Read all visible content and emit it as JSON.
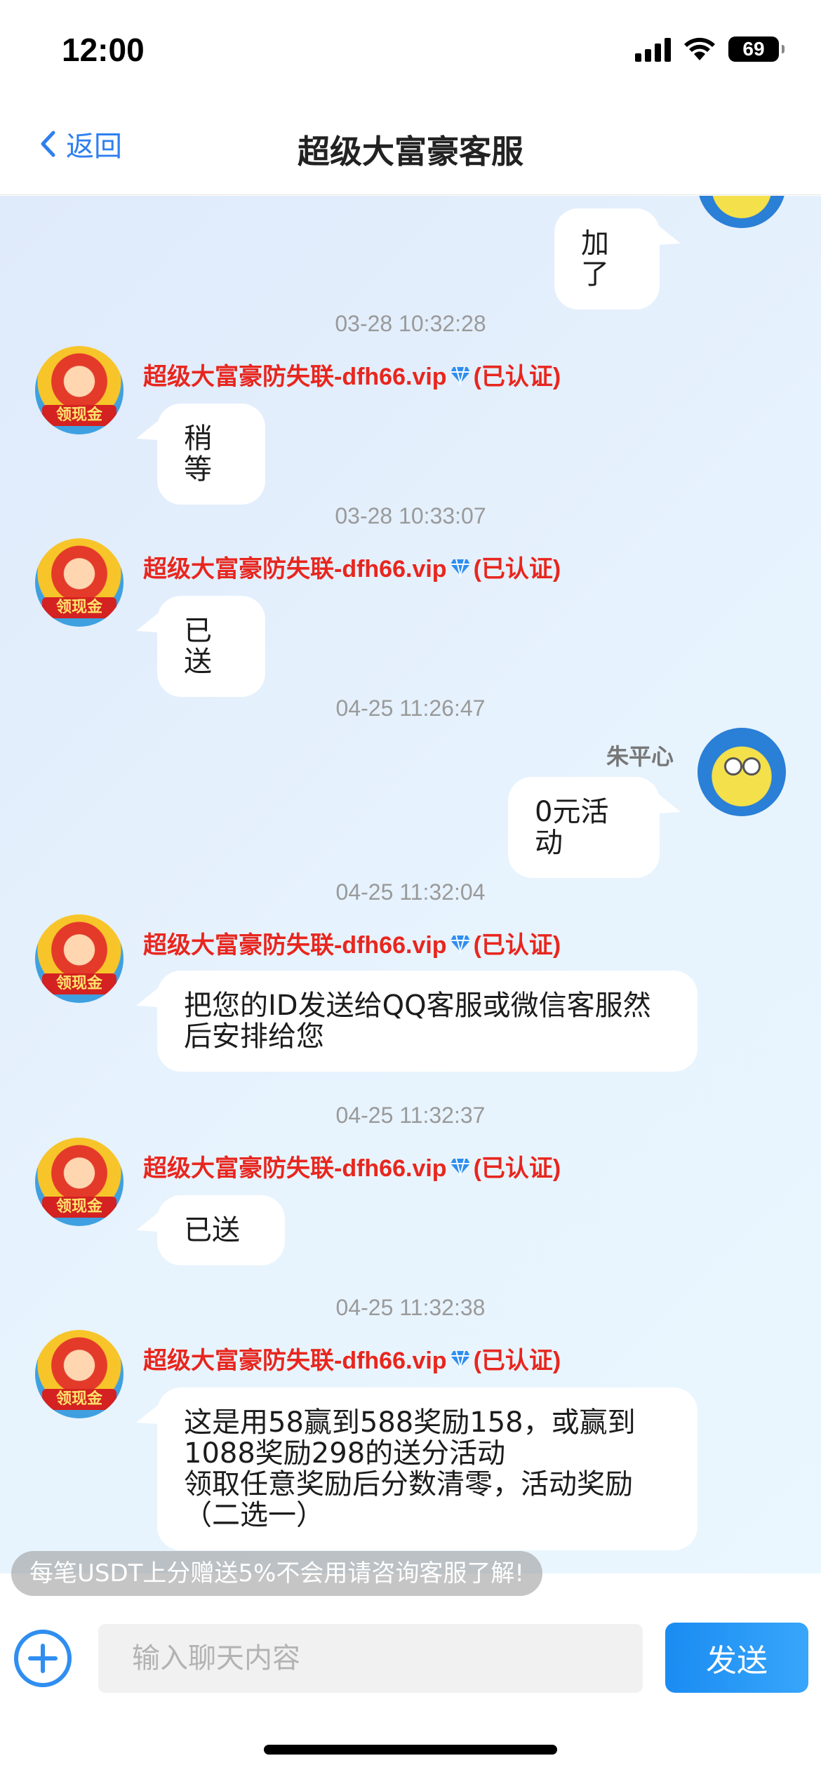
{
  "status_bar": {
    "time": "12:00",
    "battery": "69"
  },
  "nav": {
    "back_label": "返回",
    "title": "超级大富豪客服"
  },
  "messages": {
    "m0": {
      "text": "加了"
    },
    "t1": "03-28 10:32:28",
    "m1": {
      "sender": "超级大富豪防失联-dfh66.vip",
      "verified": "(已认证)",
      "text": "稍等"
    },
    "t2": "03-28 10:33:07",
    "m2": {
      "sender": "超级大富豪防失联-dfh66.vip",
      "verified": "(已认证)",
      "text": "已送"
    },
    "t3": "04-25 11:26:47",
    "m3": {
      "sender": "朱平心",
      "text": "0元活动"
    },
    "t4": "04-25 11:32:04",
    "m4": {
      "sender": "超级大富豪防失联-dfh66.vip",
      "verified": "(已认证)",
      "line1": "把您的ID发送给QQ客服或微信客服然",
      "line2": "后安排给您"
    },
    "t5": "04-25 11:32:37",
    "m5": {
      "sender": "超级大富豪防失联-dfh66.vip",
      "verified": "(已认证)",
      "text": "已送"
    },
    "t6": "04-25 11:32:38",
    "m6": {
      "sender": "超级大富豪防失联-dfh66.vip",
      "verified": "(已认证)",
      "line1": "这是用58赢到588奖励158，或赢到",
      "line2": "1088奖励298的送分活动",
      "line3": "领取任意奖励后分数清零，活动奖励",
      "line4": "（二选一）"
    }
  },
  "avatar_badge": "领现金",
  "promo": "每笔USDT上分赠送5%不会用请咨询客服了解!",
  "input": {
    "placeholder": "输入聊天内容",
    "send_label": "发送"
  },
  "colors": {
    "accent": "#2f7ff0",
    "sender_red": "#e8261e",
    "send_button": "#1a8cf2"
  }
}
